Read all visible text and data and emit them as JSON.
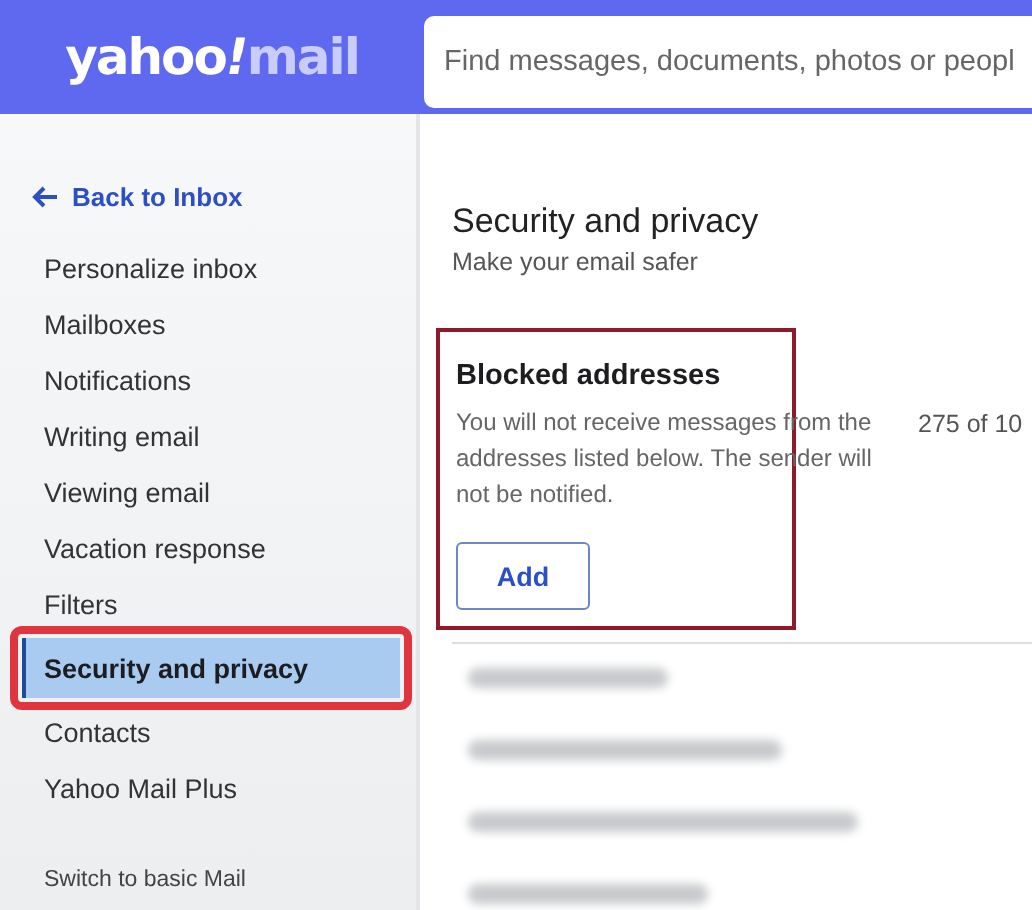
{
  "header": {
    "logo": {
      "brand": "yahoo",
      "mark": "!",
      "product": "mail"
    },
    "search": {
      "placeholder": "Find messages, documents, photos or peopl"
    }
  },
  "sidebar": {
    "back": "Back to Inbox",
    "items": [
      {
        "label": "Personalize inbox",
        "selected": false
      },
      {
        "label": "Mailboxes",
        "selected": false
      },
      {
        "label": "Notifications",
        "selected": false
      },
      {
        "label": "Writing email",
        "selected": false
      },
      {
        "label": "Viewing email",
        "selected": false
      },
      {
        "label": "Vacation response",
        "selected": false
      },
      {
        "label": "Filters",
        "selected": false
      },
      {
        "label": "Security and privacy",
        "selected": true
      },
      {
        "label": "Contacts",
        "selected": false
      },
      {
        "label": "Yahoo Mail Plus",
        "selected": false
      }
    ],
    "footer": "Switch to basic Mail"
  },
  "panel": {
    "title": "Security and privacy",
    "subtitle": "Make your email safer",
    "blocked": {
      "title": "Blocked addresses",
      "description": "You will not receive messages from the addresses listed below. The sender will not be notified.",
      "count": "275 of 10",
      "add_button": "Add"
    }
  }
}
